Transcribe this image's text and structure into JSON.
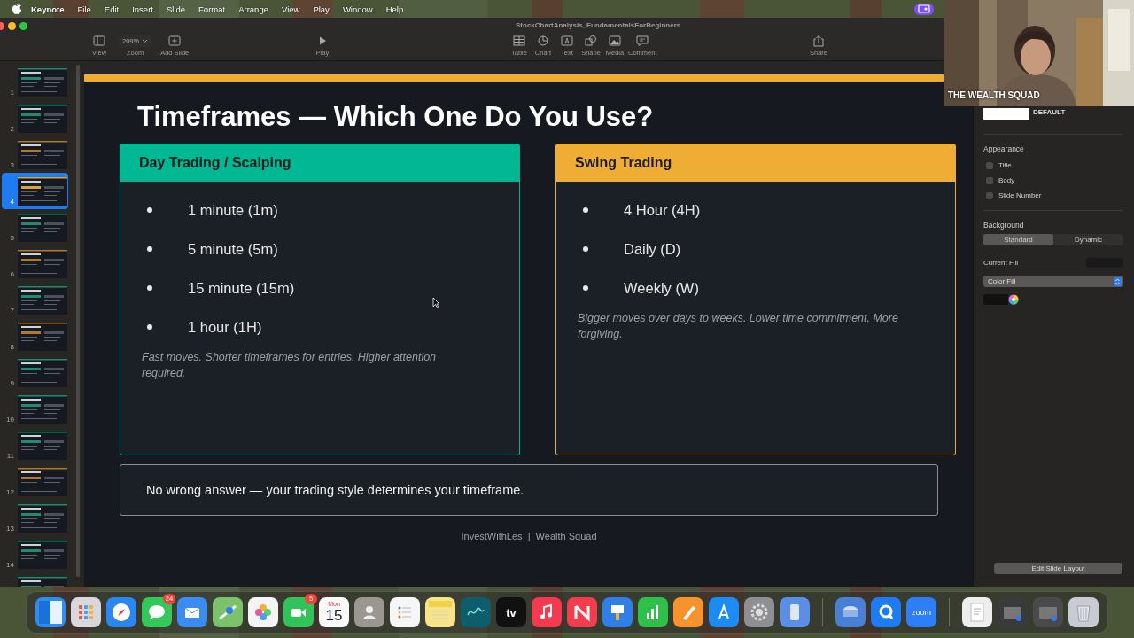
{
  "menu_bar": {
    "app": "Keynote",
    "items": [
      "File",
      "Edit",
      "Insert",
      "Slide",
      "Format",
      "Arrange",
      "View",
      "Play",
      "Window",
      "Help"
    ]
  },
  "window": {
    "title": "StockChartAnalysis_FundamentalsForBeginners",
    "zoom": "209%",
    "toolbar": {
      "left": [
        {
          "kind": "sidebar",
          "label": "View"
        },
        {
          "kind": "zoom",
          "label": "Zoom"
        },
        {
          "kind": "add",
          "label": "Add Slide"
        }
      ],
      "center": [
        {
          "kind": "play",
          "label": "Play"
        }
      ],
      "right": [
        {
          "kind": "table",
          "label": "Table"
        },
        {
          "kind": "chart",
          "label": "Chart"
        },
        {
          "kind": "text",
          "label": "Text"
        },
        {
          "kind": "shape",
          "label": "Shape"
        },
        {
          "kind": "media",
          "label": "Media"
        },
        {
          "kind": "comment",
          "label": "Comment"
        }
      ],
      "share": [
        {
          "kind": "share",
          "label": "Share"
        }
      ]
    }
  },
  "navigator": {
    "slides": [
      {
        "number": "1",
        "selected": false,
        "color": "#1e8c6e"
      },
      {
        "number": "2",
        "selected": false,
        "color": "#1e8c6e"
      },
      {
        "number": "3",
        "selected": false,
        "color": "#b07a2a"
      },
      {
        "number": "4",
        "selected": true,
        "color": "#d9a23a"
      },
      {
        "number": "5",
        "selected": false,
        "color": "#1e8c6e"
      },
      {
        "number": "6",
        "selected": false,
        "color": "#b07a2a"
      },
      {
        "number": "7",
        "selected": false,
        "color": "#1e8c6e"
      },
      {
        "number": "8",
        "selected": false,
        "color": "#b07a2a"
      },
      {
        "number": "9",
        "selected": false,
        "color": "#1e8c6e"
      },
      {
        "number": "10",
        "selected": false,
        "color": "#1e8c6e"
      },
      {
        "number": "11",
        "selected": false,
        "color": "#1e8c6e"
      },
      {
        "number": "12",
        "selected": false,
        "color": "#b07a2a"
      },
      {
        "number": "13",
        "selected": false,
        "color": "#1e8c6e"
      },
      {
        "number": "14",
        "selected": false,
        "color": "#1e8c6e"
      },
      {
        "selected": false,
        "color": "#1e8c6e"
      }
    ]
  },
  "slide": {
    "title": "Timeframes — Which One Do You Use?",
    "cards": [
      {
        "heading": "Day Trading / Scalping",
        "color": "#00b894",
        "items": [
          "1 minute (1m)",
          "5 minute (5m)",
          "15 minute (15m)",
          "1 hour (1H)"
        ],
        "note": "Fast moves. Shorter timeframes for entries. Higher attention required."
      },
      {
        "heading": "Swing Trading",
        "color": "#f0ad35",
        "items": [
          "4 Hour (4H)",
          "Daily (D)",
          "Weekly (W)"
        ],
        "note": "Bigger moves over days to weeks. Lower time commitment. More forgiving."
      }
    ],
    "callout": "No wrong answer — your trading style determines your timeframe.",
    "footer": "InvestWithLes  |  Wealth Squad"
  },
  "inspector": {
    "layout_name": "DEFAULT",
    "appearance": {
      "title": "Appearance",
      "options": [
        {
          "label": "Title",
          "checked": false
        },
        {
          "label": "Body",
          "checked": false
        },
        {
          "label": "Slide Number",
          "checked": false
        }
      ]
    },
    "background": {
      "title": "Background",
      "segments": [
        {
          "label": "Standard",
          "selected": true
        },
        {
          "label": "Dynamic",
          "selected": false
        }
      ],
      "current_fill": "Current Fill",
      "fill_type": "Color Fill"
    },
    "button": "Edit Slide Layout"
  },
  "video": {
    "label": "THE WEALTH SQUAD"
  },
  "dock": {
    "items": [
      {
        "kind": "finder",
        "color": "#2f8cf0"
      },
      {
        "kind": "grid",
        "color": "#d8d8dc"
      },
      {
        "kind": "compass",
        "color": "#2c86f0"
      },
      {
        "kind": "bubble",
        "color": "#34c759",
        "badge": "24"
      },
      {
        "kind": "envelope",
        "color": "#3a8cf0"
      },
      {
        "kind": "map",
        "color": "#7cc26a"
      },
      {
        "kind": "flower",
        "color": "#f4f4f4"
      },
      {
        "kind": "camera",
        "color": "#32c25a",
        "badge": "5"
      },
      {
        "kind": "calendar",
        "color": "#fafafa",
        "texts": [
          "Mon",
          "15"
        ]
      },
      {
        "kind": "contact",
        "color": "#9b9690"
      },
      {
        "kind": "list",
        "color": "#f6f6f6"
      },
      {
        "kind": "note",
        "color": "#f7e38a"
      },
      {
        "kind": "squiggle",
        "color": "#0d5e6a"
      },
      {
        "kind": "tv",
        "color": "#111111",
        "texts": [
          "tv"
        ]
      },
      {
        "kind": "music",
        "color": "#f43a4e"
      },
      {
        "kind": "news",
        "color": "#f23d4f"
      },
      {
        "kind": "podium",
        "color": "#2f7fe6"
      },
      {
        "kind": "bars",
        "color": "#2fbf4b"
      },
      {
        "kind": "pencil",
        "color": "#f6932c"
      },
      {
        "kind": "letter",
        "color": "#1c8cf2"
      },
      {
        "kind": "gear",
        "color": "#8e8e93"
      },
      {
        "kind": "phone",
        "color": "#5b8fe6"
      },
      {
        "kind": "separator"
      },
      {
        "kind": "disk",
        "color": "#4a7fd6"
      },
      {
        "kind": "q",
        "color": "#1e7cf2"
      },
      {
        "kind": "zoom",
        "color": "#2d7ff9",
        "texts": [
          "zoom"
        ]
      },
      {
        "kind": "separator"
      },
      {
        "kind": "doc",
        "color": "#eeeeee"
      },
      {
        "kind": "window",
        "color": "#3a3a3a"
      },
      {
        "kind": "window",
        "color": "#4a4a4a"
      },
      {
        "kind": "trash",
        "color": "#c8ccd2"
      }
    ]
  }
}
